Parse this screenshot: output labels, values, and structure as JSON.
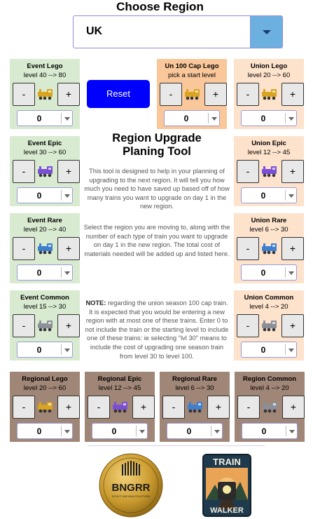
{
  "header": {
    "title": "Choose Region",
    "region_value": "UK"
  },
  "reset_label": "Reset",
  "tool": {
    "title_line1": "Region Upgrade",
    "title_line2": "Planing Tool",
    "para1": "This tool is designed to help in your planning of upgrading to the next region. It will tell you how much you need to have saved up based off of how many trains you want to upgrade on day 1 in the new region.",
    "para2": "Select the region you are moving to, along with the number of each type of train you want to upgrade on day 1 in the new region. The total cost of materials needed will be added up and listed here.",
    "note_label": "NOTE:",
    "note_text": " regarding the union season 100 cap train. It is expected that you would be entering a new region with at most one of these trains. Enter 0 to not include the train or the starting level to include one of these trains: ie selecting \"lvl 30\" means to include the cost of upgrading one season train from level 30 to level 100."
  },
  "cards": [
    {
      "title": "Event Lego",
      "levels": "level 40 --> 80",
      "minus": "-",
      "plus": "+",
      "value": "0",
      "train_icon": "gold-train-icon",
      "train_color": "#d9a520"
    },
    {
      "title": "Un 100 Cap Lego",
      "levels": "pick a start level",
      "minus": "-",
      "plus": "+",
      "value": "0",
      "train_icon": "gold-train-icon",
      "train_color": "#d9a520"
    },
    {
      "title": "Union Lego",
      "levels": "level 20 --> 60",
      "minus": "-",
      "plus": "+",
      "value": "0",
      "train_icon": "gold-train-icon",
      "train_color": "#d9a520"
    },
    {
      "title": "Event Epic",
      "levels": "level 30 --> 60",
      "minus": "-",
      "plus": "+",
      "value": "0",
      "train_icon": "purple-train-icon",
      "train_color": "#7a4fd6"
    },
    {
      "title": "Union Epic",
      "levels": "level 12 --> 45",
      "minus": "-",
      "plus": "+",
      "value": "0",
      "train_icon": "purple-train-icon",
      "train_color": "#7a4fd6"
    },
    {
      "title": "Event Rare",
      "levels": "level 20 --> 40",
      "minus": "-",
      "plus": "+",
      "value": "0",
      "train_icon": "blue-train-icon",
      "train_color": "#3f7fd0"
    },
    {
      "title": "Union Rare",
      "levels": "level 6 --> 30",
      "minus": "-",
      "plus": "+",
      "value": "0",
      "train_icon": "blue-train-icon",
      "train_color": "#3f7fd0"
    },
    {
      "title": "Event Common",
      "levels": "level 15 --> 30",
      "minus": "-",
      "plus": "+",
      "value": "0",
      "train_icon": "grey-train-icon",
      "train_color": "#8a8f98"
    },
    {
      "title": "Union Common",
      "levels": "level 4 --> 20",
      "minus": "-",
      "plus": "+",
      "value": "0",
      "train_icon": "grey-train-icon",
      "train_color": "#8a8f98"
    },
    {
      "title": "Regional Lego",
      "levels": "level 20 --> 60",
      "minus": "-",
      "plus": "+",
      "value": "0",
      "train_icon": "gold-train-icon",
      "train_color": "#d9a520"
    },
    {
      "title": "Regional Epic",
      "levels": "level 12 --> 45",
      "minus": "-",
      "plus": "+",
      "value": "0",
      "train_icon": "purple-train-icon",
      "train_color": "#7a4fd6"
    },
    {
      "title": "Regional Rare",
      "levels": "level 6 --> 30",
      "minus": "-",
      "plus": "+",
      "value": "0",
      "train_icon": "blue-train-icon",
      "train_color": "#3f7fd0"
    },
    {
      "title": "Region Common",
      "levels": "level 4 --> 20",
      "minus": "-",
      "plus": "+",
      "value": "0",
      "train_icon": "grey-train-icon",
      "train_color": "#8a8f98"
    }
  ],
  "logos": {
    "bngrr_text": "BNGRR",
    "bngrr_subtext": "SELECT AND BUILD PLATFORM",
    "train_walker_top": "TRAIN",
    "train_walker_bottom": "WALKER"
  },
  "colors": {
    "event_card": "#d8ead0",
    "union_cap_card": "#f9c79a",
    "union_card": "#fde2cc",
    "regional_card": "#a08676",
    "reset_button": "#0000ff",
    "dropdown_arrow": "#6bb0df"
  }
}
